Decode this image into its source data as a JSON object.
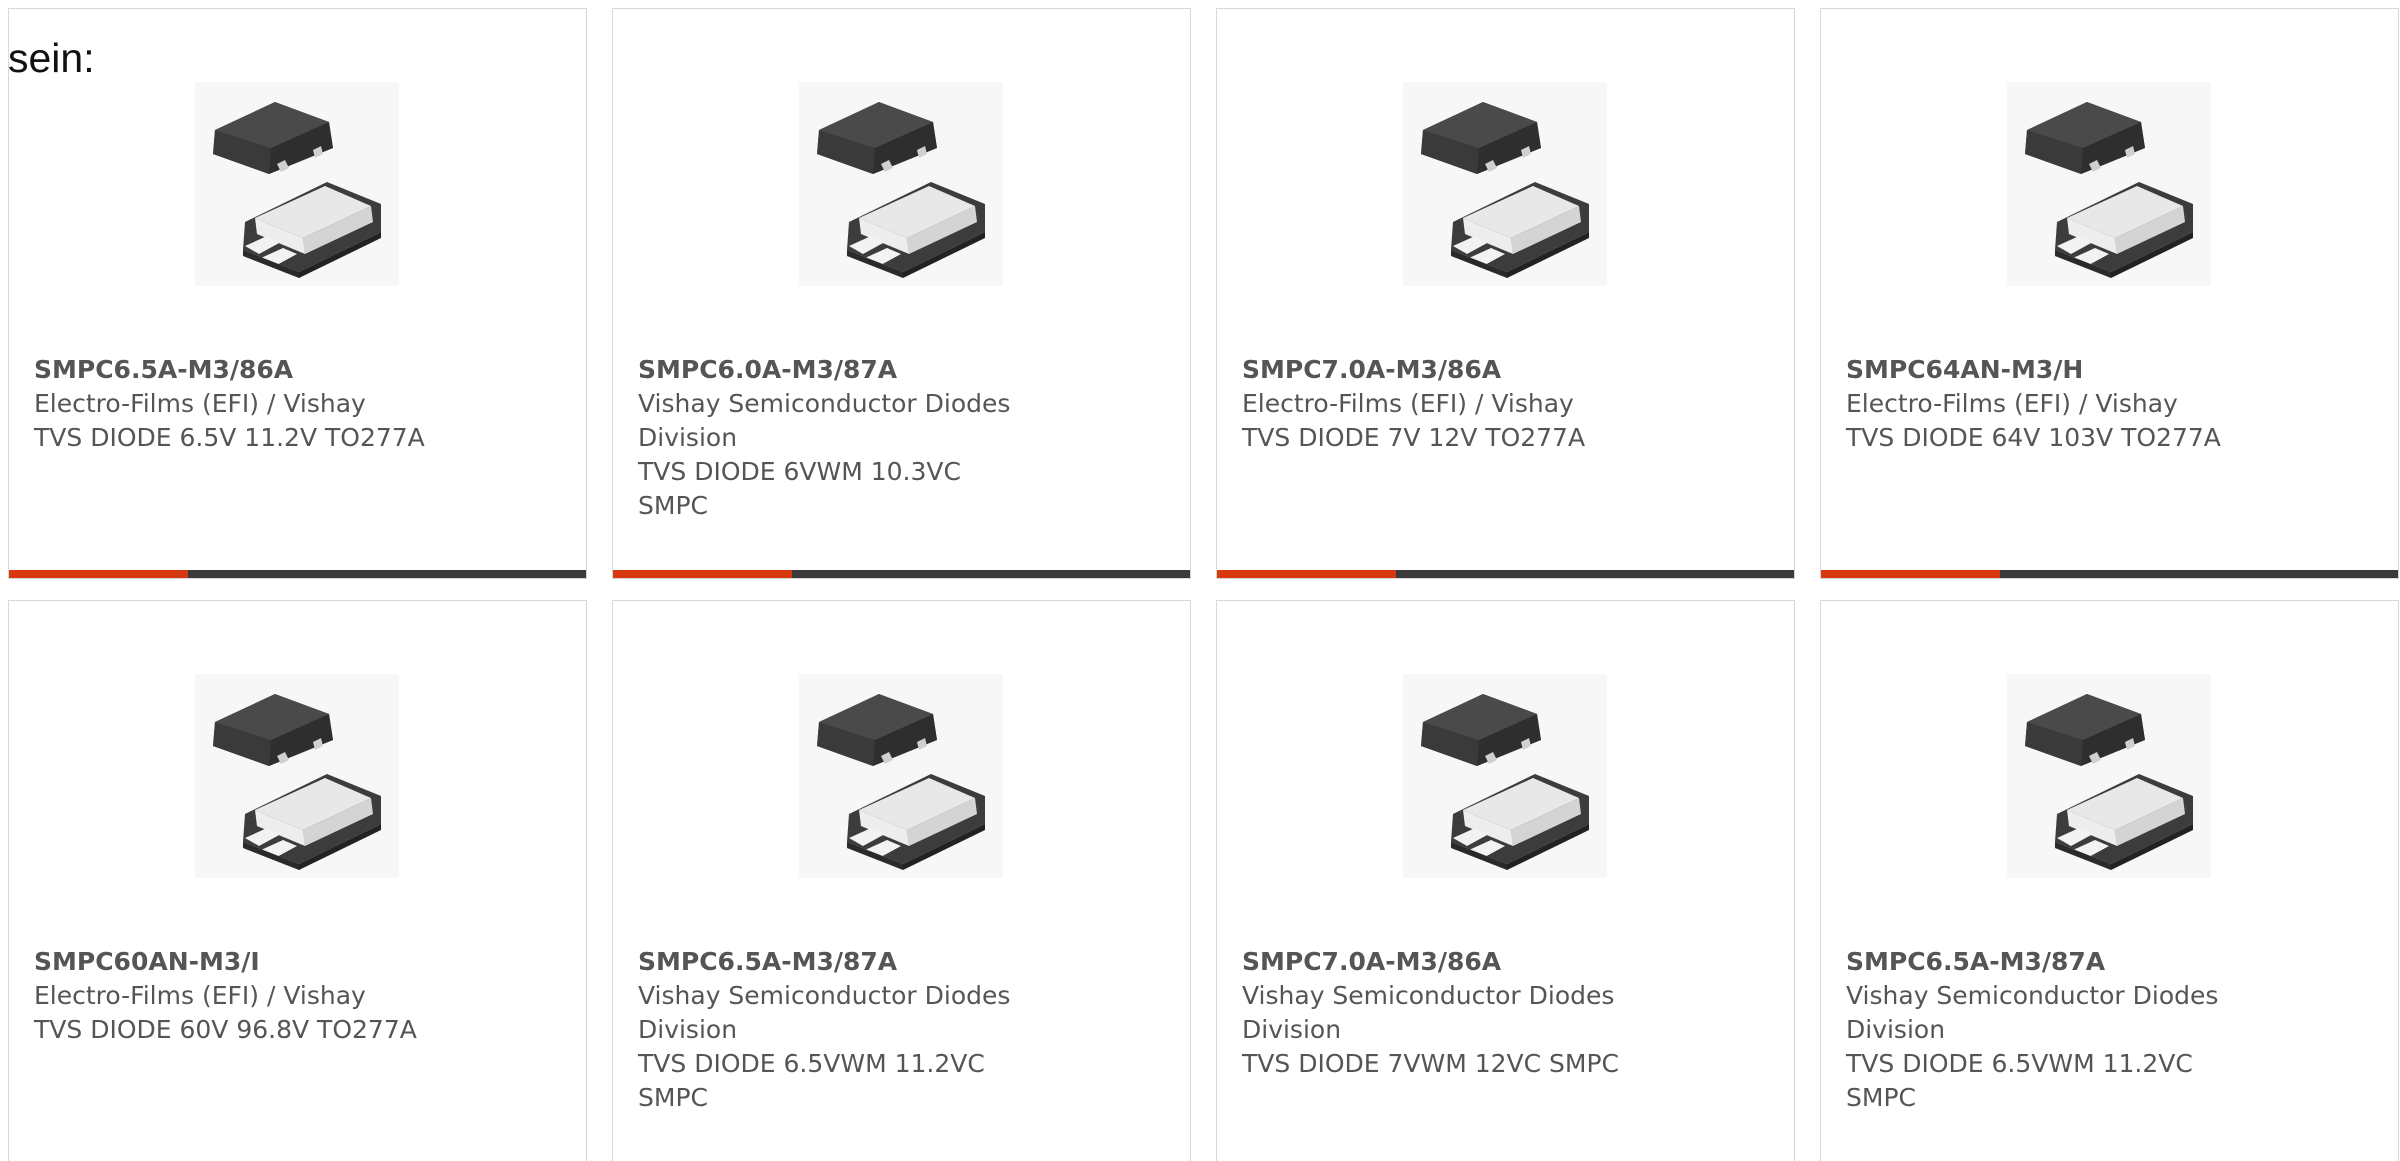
{
  "intro_text": "sein:",
  "colors": {
    "accent": "#d8380f",
    "bar_track": "#3a3a3a",
    "text": "#555555",
    "card_border": "#d8d8d8"
  },
  "products": [
    {
      "part_number": "SMPC6.5A-M3/86A",
      "manufacturer": "Electro-Films (EFI) / Vishay",
      "description": "TVS DIODE 6.5V 11.2V TO277A",
      "image": "smpc-package-photo",
      "bar_accent_fraction": 0.31
    },
    {
      "part_number": "SMPC6.0A-M3/87A",
      "manufacturer": "Vishay Semiconductor Diodes Division",
      "description": "TVS DIODE 6VWM 10.3VC SMPC",
      "image": "smpc-package-photo",
      "bar_accent_fraction": 0.31
    },
    {
      "part_number": "SMPC7.0A-M3/86A",
      "manufacturer": "Electro-Films (EFI) / Vishay",
      "description": "TVS DIODE 7V 12V TO277A",
      "image": "smpc-package-photo",
      "bar_accent_fraction": 0.31
    },
    {
      "part_number": "SMPC64AN-M3/H",
      "manufacturer": "Electro-Films (EFI) / Vishay",
      "description": "TVS DIODE 64V 103V TO277A",
      "image": "smpc-package-photo",
      "bar_accent_fraction": 0.31
    },
    {
      "part_number": "SMPC60AN-M3/I",
      "manufacturer": "Electro-Films (EFI) / Vishay",
      "description": "TVS DIODE 60V 96.8V TO277A",
      "image": "smpc-package-photo",
      "bar_accent_fraction": 0.31
    },
    {
      "part_number": "SMPC6.5A-M3/87A",
      "manufacturer": "Vishay Semiconductor Diodes Division",
      "description": "TVS DIODE 6.5VWM 11.2VC SMPC",
      "image": "smpc-package-photo",
      "bar_accent_fraction": 0.31
    },
    {
      "part_number": "SMPC7.0A-M3/86A",
      "manufacturer": "Vishay Semiconductor Diodes Division",
      "description": "TVS DIODE 7VWM 12VC SMPC",
      "image": "smpc-package-photo",
      "bar_accent_fraction": 0.31
    },
    {
      "part_number": "SMPC6.5A-M3/87A",
      "manufacturer": "Vishay Semiconductor Diodes Division",
      "description": "TVS DIODE 6.5VWM 11.2VC SMPC",
      "image": "smpc-package-photo",
      "bar_accent_fraction": 0.31
    }
  ]
}
